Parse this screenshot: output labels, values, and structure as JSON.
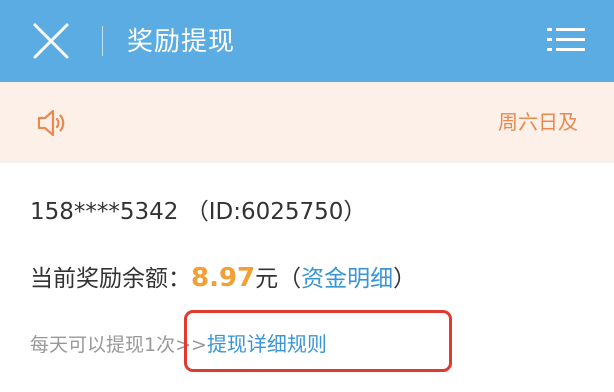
{
  "header": {
    "title": "奖励提现",
    "close_icon": "close-icon",
    "menu_icon": "menu-icon",
    "background": "#5bace2"
  },
  "notice": {
    "icon": "speaker-icon",
    "text": "周六日及",
    "color": "#e88a4f"
  },
  "account": {
    "text": "158****5342 （ID:6025750）"
  },
  "balance": {
    "label": "当前奖励余额：",
    "amount": "8.97",
    "unit": "元",
    "paren_open": "（",
    "details_link": "资金明细",
    "paren_close": "）",
    "amount_color": "#f0a035"
  },
  "withdraw_rule": {
    "text": "每天可以提现1次>>",
    "link": "提现详细规则",
    "highlight_color": "#e1392d"
  }
}
